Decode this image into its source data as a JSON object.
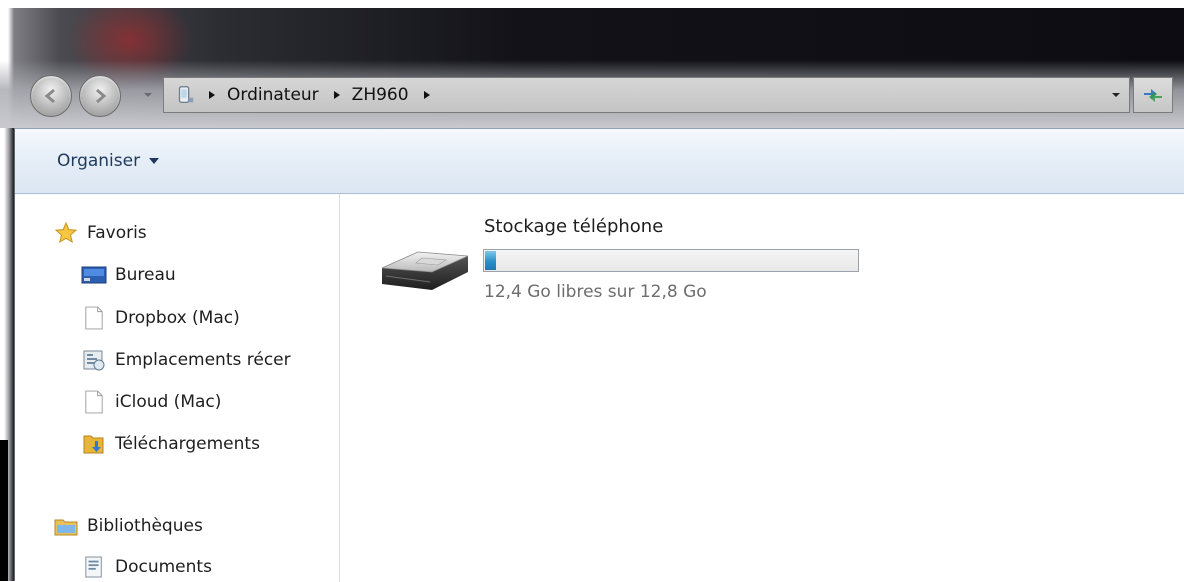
{
  "address": {
    "crumbs": [
      "Ordinateur",
      "ZH960"
    ]
  },
  "toolbar": {
    "organise_label": "Organiser"
  },
  "nav": {
    "favorites": {
      "header": "Favoris",
      "items": [
        {
          "label": "Bureau",
          "icon": "desktop-icon"
        },
        {
          "label": "Dropbox (Mac)",
          "icon": "document-icon"
        },
        {
          "label": "Emplacements récer",
          "icon": "recent-places-icon"
        },
        {
          "label": "iCloud (Mac)",
          "icon": "document-icon"
        },
        {
          "label": "Téléchargements",
          "icon": "downloads-folder-icon"
        }
      ]
    },
    "libraries": {
      "header": "Bibliothèques",
      "items": [
        {
          "label": "Documents",
          "icon": "documents-library-icon"
        }
      ]
    }
  },
  "content": {
    "drive": {
      "name": "Stockage téléphone",
      "free_text": "12,4 Go libres sur 12,8 Go",
      "used_fraction": 0.03
    }
  },
  "colors": {
    "toolbar_text": "#1e395b",
    "progress_fill": "#2b8fc7",
    "free_text": "#6d6d6d"
  }
}
